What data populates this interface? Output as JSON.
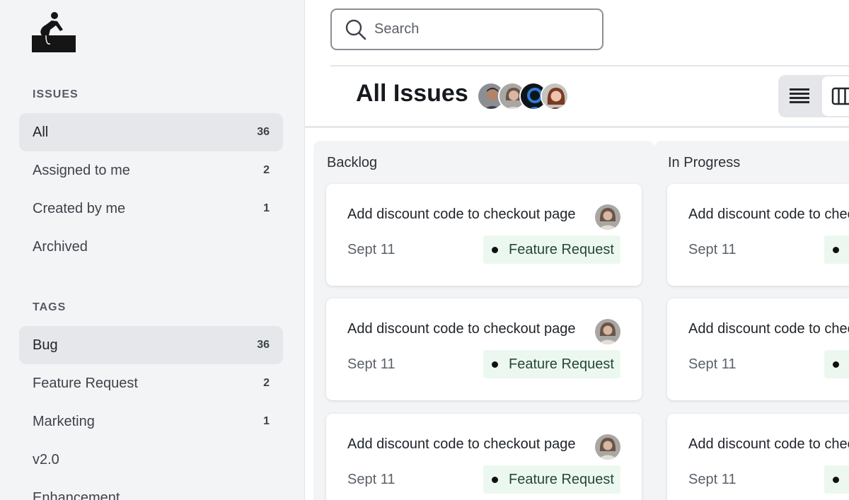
{
  "sidebar": {
    "issues_title": "ISSUES",
    "issues": [
      {
        "label": "All",
        "count": "36",
        "active": true
      },
      {
        "label": "Assigned to me",
        "count": "2"
      },
      {
        "label": "Created by me",
        "count": "1"
      },
      {
        "label": "Archived",
        "count": ""
      }
    ],
    "tags_title": "TAGS",
    "tags": [
      {
        "label": "Bug",
        "count": "36",
        "active": true
      },
      {
        "label": "Feature Request",
        "count": "2"
      },
      {
        "label": "Marketing",
        "count": "1"
      },
      {
        "label": "v2.0",
        "count": ""
      },
      {
        "label": "Enhancement",
        "count": ""
      }
    ]
  },
  "search": {
    "placeholder": "Search"
  },
  "header": {
    "title": "All Issues",
    "view_modes": [
      "list-view-icon",
      "board-view-icon"
    ]
  },
  "columns": [
    {
      "title": "Backlog",
      "cards": [
        {
          "title": "Add discount code to checkout page",
          "date": "Sept 11",
          "tag": "Feature Request"
        },
        {
          "title": "Add discount code to checkout page",
          "date": "Sept 11",
          "tag": "Feature Request"
        },
        {
          "title": "Add discount code to checkout page",
          "date": "Sept 11",
          "tag": "Feature Request"
        }
      ]
    },
    {
      "title": "In Progress",
      "cards": [
        {
          "title": "Add discount code to checkout page",
          "date": "Sept 11"
        },
        {
          "title": "Add discount code to checkout page",
          "date": "Sept 11"
        },
        {
          "title": "Add discount code to checkout page",
          "date": "Sept 11"
        }
      ]
    }
  ],
  "colors": {
    "sidebar_bg": "#f3f4f6",
    "active_item": "#e5e7ea",
    "tag_bg": "#ecf8ef",
    "tag_text": "#26463a",
    "column_bg": "#f3f4f6"
  }
}
